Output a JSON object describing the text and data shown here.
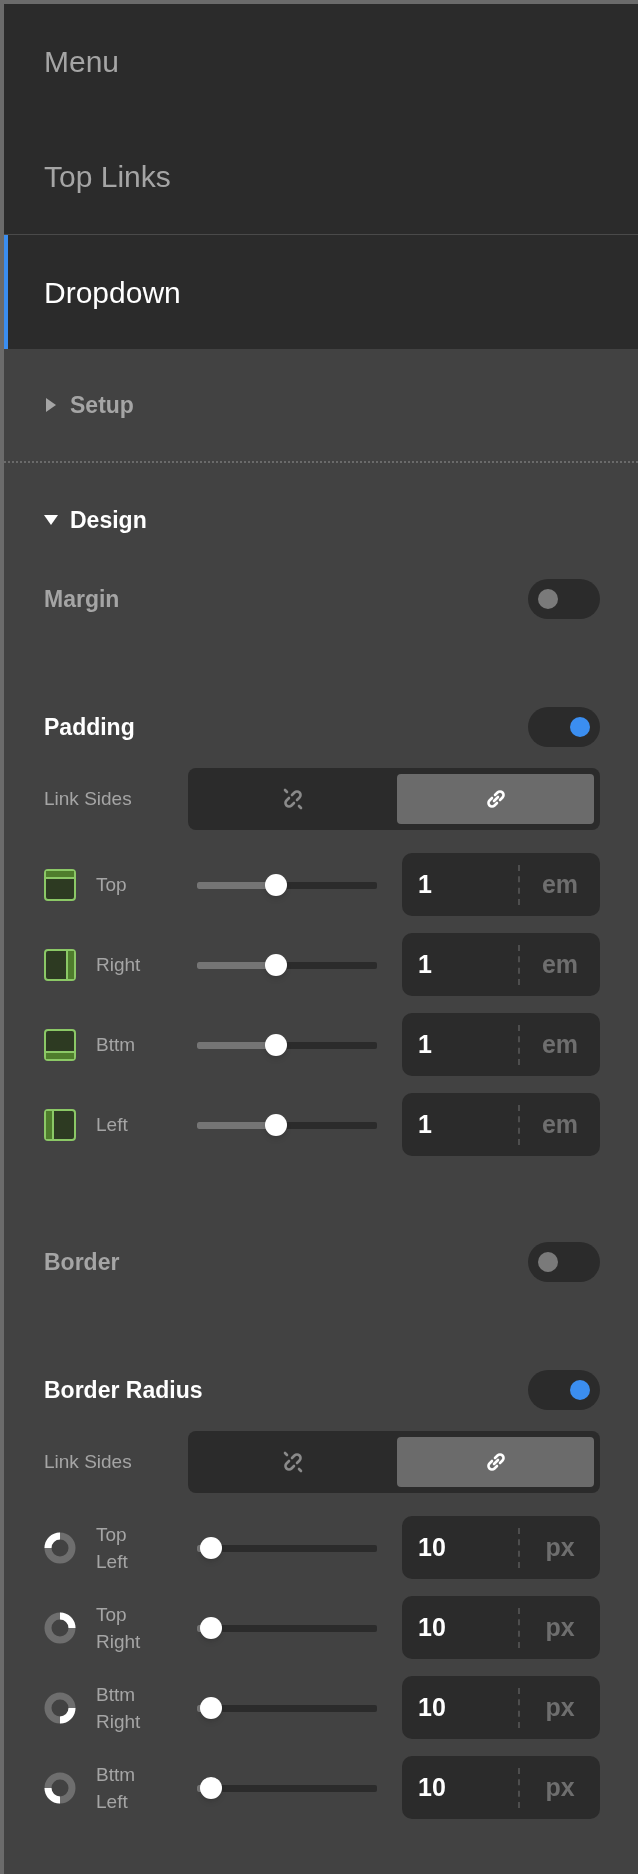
{
  "nav": [
    {
      "label": "Menu",
      "selected": false
    },
    {
      "label": "Top Links",
      "selected": false
    },
    {
      "label": "Dropdown",
      "selected": true
    }
  ],
  "sections": [
    {
      "title": "Setup",
      "expanded": false
    },
    {
      "title": "Design",
      "expanded": true
    }
  ],
  "groups": [
    {
      "title": "Margin",
      "on": false
    },
    {
      "title": "Padding",
      "on": true,
      "link_sides": {
        "label": "Link Sides",
        "options": [
          {
            "kind": "unlinked",
            "selected": false
          },
          {
            "kind": "linked",
            "selected": true
          }
        ]
      },
      "rows": [
        {
          "kind": "top",
          "label": "Top",
          "level": 0.44,
          "value": "1",
          "unit": "em"
        },
        {
          "kind": "right",
          "label": "Right",
          "level": 0.44,
          "value": "1",
          "unit": "em"
        },
        {
          "kind": "bottom",
          "label": "Bttm",
          "level": 0.44,
          "value": "1",
          "unit": "em"
        },
        {
          "kind": "left",
          "label": "Left",
          "level": 0.44,
          "value": "1",
          "unit": "em"
        }
      ]
    },
    {
      "title": "Border",
      "on": false
    },
    {
      "title": "Border Radius",
      "on": true,
      "link_sides": {
        "label": "Link Sides",
        "options": [
          {
            "kind": "unlinked",
            "selected": false
          },
          {
            "kind": "linked",
            "selected": true
          }
        ]
      },
      "rows": [
        {
          "kind": "topleft",
          "label": "Top Left",
          "level": 0.08,
          "value": "10",
          "unit": "px"
        },
        {
          "kind": "topright",
          "label": "Top Right",
          "level": 0.08,
          "value": "10",
          "unit": "px"
        },
        {
          "kind": "bottomright",
          "label": "Bttm Right",
          "level": 0.08,
          "value": "10",
          "unit": "px"
        },
        {
          "kind": "bottomleft",
          "label": "Bttm Left",
          "level": 0.08,
          "value": "10",
          "unit": "px"
        }
      ]
    }
  ]
}
